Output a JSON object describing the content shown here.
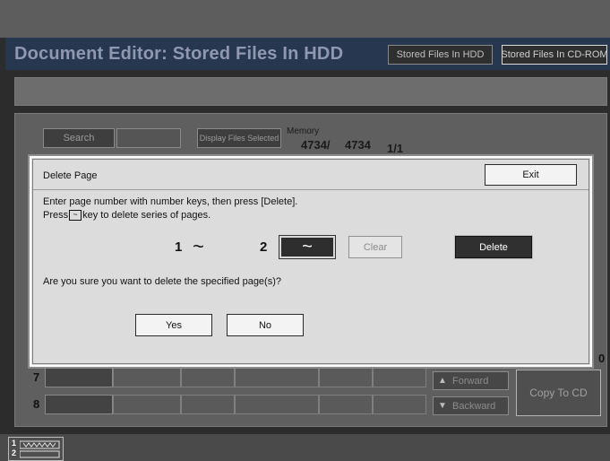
{
  "header": {
    "title": "Document Editor: Stored Files In HDD",
    "tabs": [
      "Stored Files In HDD",
      "Stored Files In CD-ROM"
    ]
  },
  "toolbar": {
    "search_label": "Search",
    "display_selected_label": "Display Files Selected",
    "memory_label": "Memory",
    "memory_free": "4734/",
    "memory_total": "4734",
    "page_indicator": "1/1"
  },
  "file_rows": [
    {
      "number": "7"
    },
    {
      "number": "8"
    }
  ],
  "navigation": {
    "forward_label": "Forward",
    "backward_label": "Backward",
    "copy_to_cd_label": "Copy To CD",
    "page_number_partial": "0"
  },
  "status": {
    "job_markers": [
      "1",
      "2"
    ]
  },
  "dialog": {
    "title": "Delete Page",
    "exit_label": "Exit",
    "instruction_line1": "Enter page number with number keys, then press [Delete].",
    "instruction_line2_pre": "Press",
    "instruction_line2_post": "key to delete series of pages.",
    "tilde_symbol": "~",
    "start_page": "1",
    "range_symbol": "~",
    "end_page": "2",
    "range_key_symbol": "~",
    "clear_label": "Clear",
    "delete_label": "Delete",
    "confirm_question": "Are you sure you want to delete the specified page(s)?",
    "yes_label": "Yes",
    "no_label": "No"
  }
}
